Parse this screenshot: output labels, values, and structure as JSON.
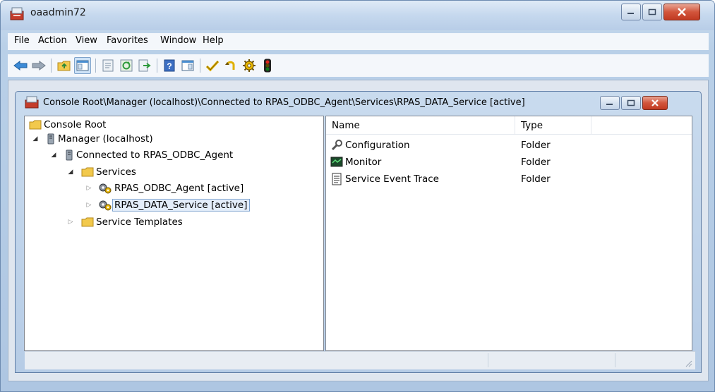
{
  "window": {
    "title": "oaadmin72"
  },
  "menu": {
    "items": [
      {
        "label": "File"
      },
      {
        "label": "Action"
      },
      {
        "label": "View"
      },
      {
        "label": "Favorites"
      },
      {
        "label": "Window"
      },
      {
        "label": "Help"
      }
    ]
  },
  "toolbar": {
    "buttons": [
      {
        "icon": "back-arrow-icon"
      },
      {
        "icon": "forward-arrow-icon"
      },
      {
        "icon": "up-folder-icon"
      },
      {
        "icon": "show-console-tree-icon"
      },
      {
        "icon": "properties-icon"
      },
      {
        "icon": "refresh-icon"
      },
      {
        "icon": "export-list-icon"
      },
      {
        "icon": "help-icon"
      },
      {
        "icon": "action-pane-icon"
      },
      {
        "icon": "check-icon"
      },
      {
        "icon": "undo-icon"
      },
      {
        "icon": "gear-icon"
      },
      {
        "icon": "traffic-light-icon"
      }
    ]
  },
  "console": {
    "title": "Console Root\\Manager (localhost)\\Connected to RPAS_ODBC_Agent\\Services\\RPAS_DATA_Service [active]"
  },
  "tree": {
    "root": "Console Root",
    "manager": "Manager (localhost)",
    "connection": "Connected to RPAS_ODBC_Agent",
    "services": "Services",
    "service_1": "RPAS_ODBC_Agent [active]",
    "service_2": "RPAS_DATA_Service [active]",
    "templates": "Service Templates"
  },
  "list": {
    "columns": [
      "Name",
      "Type"
    ],
    "rows": [
      {
        "name": "Configuration",
        "type": "Folder",
        "icon": "wrench-icon"
      },
      {
        "name": "Monitor",
        "type": "Folder",
        "icon": "monitor-icon"
      },
      {
        "name": "Service Event Trace",
        "type": "Folder",
        "icon": "document-icon"
      }
    ]
  },
  "colors": {
    "accent": "#2a6ebb",
    "selection": "#e4eefa",
    "folder": "#f2c94c"
  }
}
